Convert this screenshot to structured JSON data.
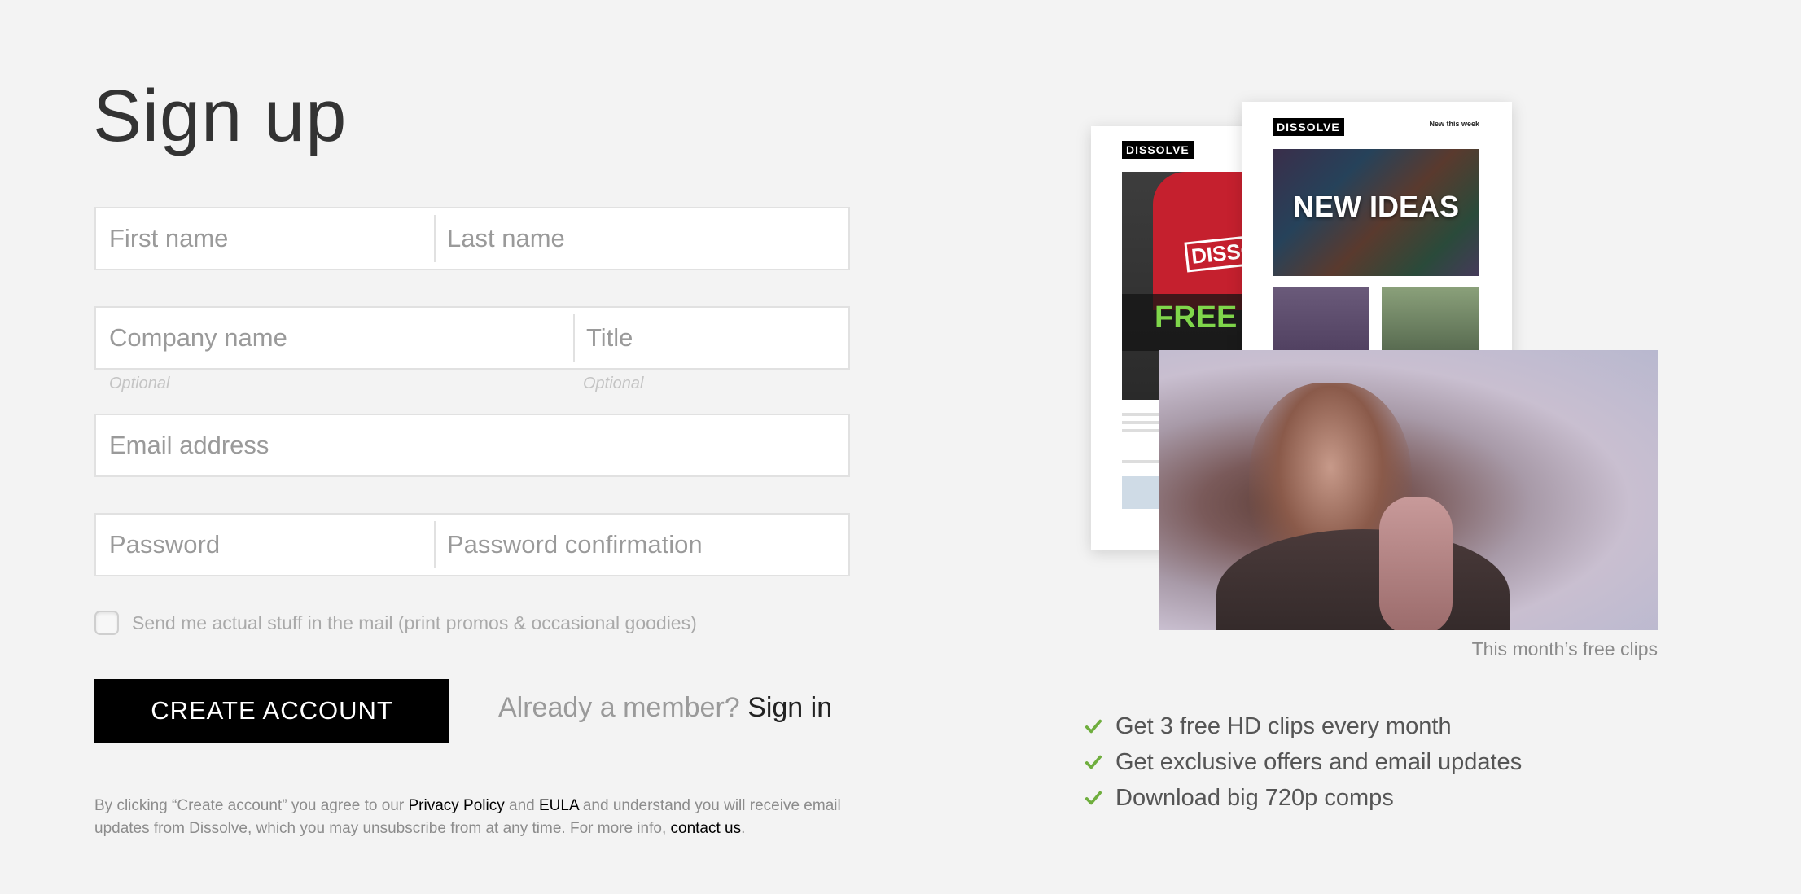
{
  "page": {
    "title": "Sign up"
  },
  "form": {
    "first_name_placeholder": "First name",
    "last_name_placeholder": "Last name",
    "company_placeholder": "Company name",
    "title_placeholder": "Title",
    "company_hint": "Optional",
    "title_hint": "Optional",
    "email_placeholder": "Email address",
    "password_placeholder": "Password",
    "password_confirm_placeholder": "Password confirmation",
    "mail_opt_in_label": "Send me actual stuff in the mail (print promos & occasional goodies)",
    "mail_opt_in_checked": false,
    "create_button_label": "CREATE ACCOUNT",
    "member_prompt": "Already a member?",
    "sign_in_link": "Sign in"
  },
  "legal": {
    "part1": "By clicking “Create account” you agree to our ",
    "privacy_link": "Privacy Policy",
    "part2": " and ",
    "eula_link": "EULA",
    "part3": " and understand you will receive email updates from Dissolve, which you may unsubscribe from at any time. For more info, ",
    "contact_link": "contact us",
    "part4": "."
  },
  "promo": {
    "newsletter_logo": "DISSOLVE",
    "newsletter_logo_2": "DISSOLVE",
    "newsletter_header": "New this week",
    "tshirt_text": "DISSOLV",
    "free_text": "FREE T-S",
    "new_ideas_text": "NEW IDEAS",
    "caption": "This month’s free clips",
    "benefits": [
      "Get 3 free HD clips every month",
      "Get exclusive offers and email updates",
      "Download big 720p comps"
    ],
    "accent_color": "#6fae3e"
  }
}
